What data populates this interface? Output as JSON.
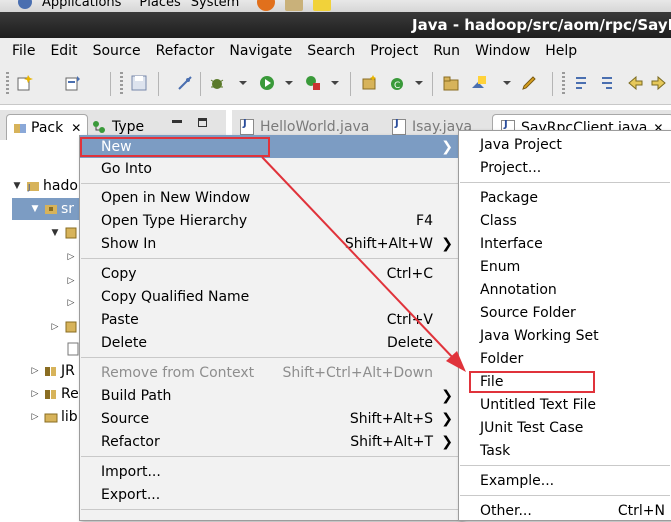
{
  "panel": {
    "applications": "Applications",
    "places": "Places",
    "system": "System"
  },
  "window": {
    "title": "Java - hadoop/src/aom/rpc/SayRpc"
  },
  "menubar": [
    "File",
    "Edit",
    "Source",
    "Refactor",
    "Navigate",
    "Search",
    "Project",
    "Run",
    "Window",
    "Help"
  ],
  "left_tabs": {
    "package": "Pack",
    "type": "Type"
  },
  "editor_tabs": [
    "HelloWorld.java",
    "Isay.java",
    "SayRpcClient.java"
  ],
  "tree": {
    "project": "hado",
    "src": "sr",
    "jre": "JR",
    "ref": "Re",
    "lib": "lib"
  },
  "context_menu": [
    {
      "label": "New",
      "accel": ""
    },
    {
      "label": "Go Into",
      "accel": ""
    },
    {
      "label": "Open in New Window",
      "accel": ""
    },
    {
      "label": "Open Type Hierarchy",
      "accel": "F4"
    },
    {
      "label": "Show In",
      "accel": "Shift+Alt+W"
    },
    {
      "label": "Copy",
      "accel": "Ctrl+C"
    },
    {
      "label": "Copy Qualified Name",
      "accel": ""
    },
    {
      "label": "Paste",
      "accel": "Ctrl+V"
    },
    {
      "label": "Delete",
      "accel": "Delete"
    },
    {
      "label": "Remove from Context",
      "accel": "Shift+Ctrl+Alt+Down"
    },
    {
      "label": "Build Path",
      "accel": ""
    },
    {
      "label": "Source",
      "accel": "Shift+Alt+S"
    },
    {
      "label": "Refactor",
      "accel": "Shift+Alt+T"
    },
    {
      "label": "Import...",
      "accel": ""
    },
    {
      "label": "Export...",
      "accel": ""
    }
  ],
  "new_submenu": [
    {
      "label": "Java Project",
      "accel": ""
    },
    {
      "label": "Project...",
      "accel": ""
    },
    {
      "label": "Package",
      "accel": ""
    },
    {
      "label": "Class",
      "accel": ""
    },
    {
      "label": "Interface",
      "accel": ""
    },
    {
      "label": "Enum",
      "accel": ""
    },
    {
      "label": "Annotation",
      "accel": ""
    },
    {
      "label": "Source Folder",
      "accel": ""
    },
    {
      "label": "Java Working Set",
      "accel": ""
    },
    {
      "label": "Folder",
      "accel": ""
    },
    {
      "label": "File",
      "accel": ""
    },
    {
      "label": "Untitled Text File",
      "accel": ""
    },
    {
      "label": "JUnit Test Case",
      "accel": ""
    },
    {
      "label": "Task",
      "accel": ""
    },
    {
      "label": "Example...",
      "accel": ""
    },
    {
      "label": "Other...",
      "accel": "Ctrl+N"
    }
  ],
  "colors": {
    "highlight": "#7c9cc3",
    "callout": "#e0333b",
    "titlebar": "#1e1e1e"
  }
}
